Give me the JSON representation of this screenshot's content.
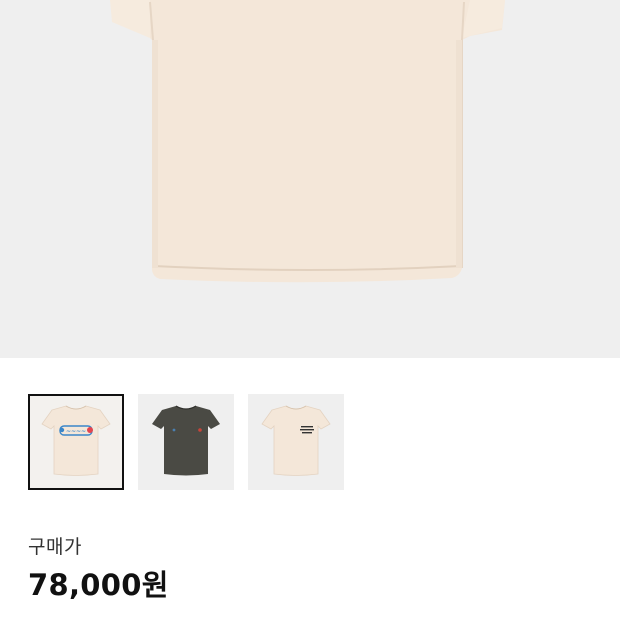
{
  "product": {
    "main_image": {
      "icon": "tshirt-cream-icon",
      "color": "#f3e6d8"
    },
    "thumbnails": [
      {
        "icon": "tshirt-cream-graphic-icon",
        "color": "#f3e6d8",
        "selected": true
      },
      {
        "icon": "tshirt-charcoal-icon",
        "color": "#4a4a44",
        "selected": false
      },
      {
        "icon": "tshirt-cream-text-icon",
        "color": "#f3e6d8",
        "selected": false
      }
    ]
  },
  "price": {
    "label": "구매가",
    "value": "78,000원"
  },
  "colors": {
    "hero_bg": "#efefef",
    "thumb_border": "#111111"
  }
}
